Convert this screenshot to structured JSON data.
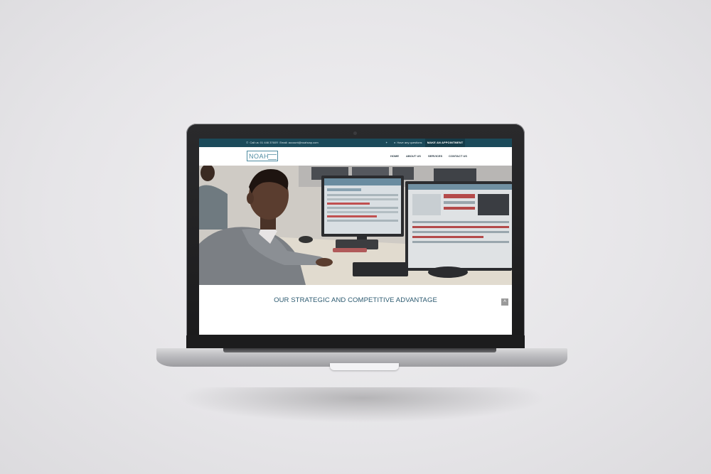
{
  "topbar": {
    "phone": "Call us: 01 446 3760",
    "email": "Email: account@noahcap.com",
    "questions": "Have any questions",
    "appointment_button": "MAKE AN APPOINTMENT"
  },
  "nav": {
    "logo_text": "NOAH",
    "items": [
      "HOME",
      "ABOUT US",
      "SERVICES",
      "CONTACT US"
    ]
  },
  "hero": {
    "headline": "OUR STRATEGIC AND COMPETITIVE ADVANTAGE"
  },
  "icons": {
    "phone": "phone-icon",
    "email": "envelope-icon",
    "twitter": "twitter-icon",
    "question": "question-circle-icon",
    "back_to_top": "chevron-up-icon"
  },
  "colors": {
    "topbar": "#1b4a5a",
    "accent": "#2c5a70",
    "logo": "#4d8aa0"
  }
}
